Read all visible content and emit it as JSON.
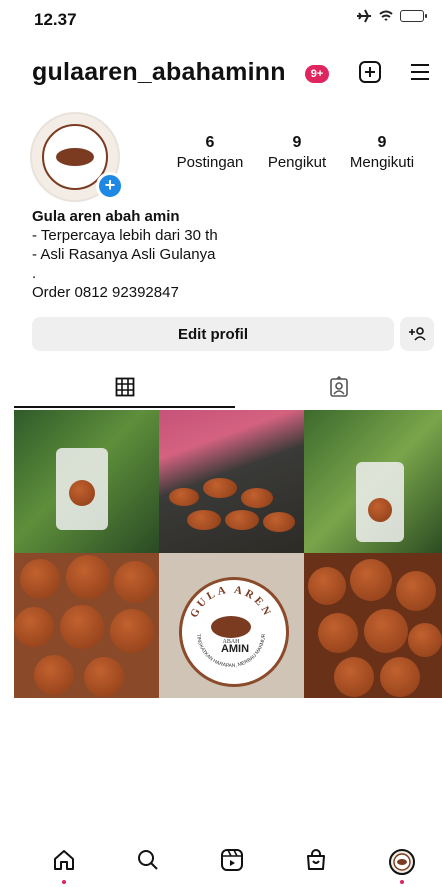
{
  "status_bar": {
    "time": "12.37"
  },
  "header": {
    "username": "gulaaren_abahaminn",
    "notification_badge": "9+"
  },
  "profile": {
    "stats": [
      {
        "value": "6",
        "label": "Postingan"
      },
      {
        "value": "9",
        "label": "Pengikut"
      },
      {
        "value": "9",
        "label": "Mengikuti"
      }
    ],
    "bio": {
      "name": "Gula aren abah amin",
      "lines": [
        "- Terpercaya lebih dari 30 th",
        "- Asli Rasanya Asli Gulanya",
        ".",
        "Order 0812 92392847"
      ]
    }
  },
  "actions": {
    "edit_profile": "Edit profil"
  },
  "tabs": [
    {
      "icon": "grid-icon",
      "active": true
    },
    {
      "icon": "tagged-icon",
      "active": false
    }
  ],
  "grid_items": [
    {
      "icon": "photo-bag-in-hand"
    },
    {
      "icon": "photo-sugar-pieces-on-cloth"
    },
    {
      "icon": "photo-bag-on-plant"
    },
    {
      "icon": "photo-sugar-closeup"
    },
    {
      "icon": "photo-logo"
    },
    {
      "icon": "photo-sugar-pile"
    }
  ],
  "logo": {
    "brand": "GULA AREN",
    "sub_top": "ABAH",
    "sub_main": "AMIN",
    "tagline": "TINGKATKAN HARAPAN, MERBAU MAKMUR"
  },
  "bottom_nav": [
    "home-icon",
    "search-icon",
    "reels-icon",
    "shop-icon",
    "profile-icon"
  ],
  "colors": {
    "accent_red": "#e0245e",
    "blue": "#1e88e5",
    "button_gray": "#efefef"
  }
}
